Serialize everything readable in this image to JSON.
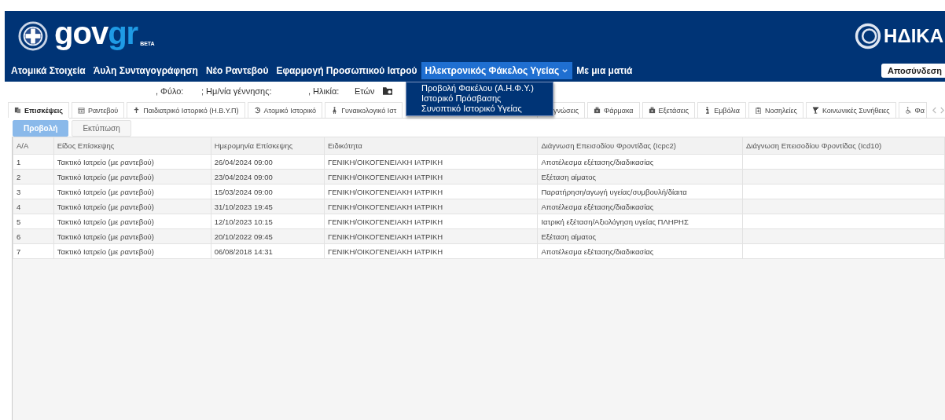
{
  "header": {
    "logo_text": "govgr",
    "badge": "BETA",
    "right_logo_text": "ΗΔΙΚΑ",
    "logout_button": "Αποσύνδεση"
  },
  "nav": [
    {
      "label": "Ατομικά Στοιχεία",
      "selected": false,
      "kind": "link"
    },
    {
      "label": "Άυλη Συνταγογράφηση",
      "selected": false,
      "kind": "link"
    },
    {
      "label": "Νέο Ραντεβού",
      "selected": false,
      "kind": "link"
    },
    {
      "label": "Εφαρμογή Προσωπικού Ιατρού",
      "selected": false,
      "kind": "link"
    },
    {
      "label": "Ηλεκτρονικός Φάκελος Υγείας",
      "selected": true,
      "kind": "menu"
    },
    {
      "label": "Με μια ματιά",
      "selected": false,
      "kind": "link"
    }
  ],
  "dropdown_menu": [
    "Προβολή Φακέλου (Α.Η.Φ.Υ.)",
    "Ιστορικό Πρόσβασης",
    "Συνοπτικό Ιστορικό Υγείας"
  ],
  "patient_info": [
    ", Φύλο:",
    "; Ημ/νία γέννησης:",
    ", Ηλικία:",
    "Ετών"
  ],
  "tabs": [
    {
      "label": "Επισκέψεις",
      "selected": true
    },
    {
      "label": "Ραντεβού",
      "selected": false
    },
    {
      "label": "Παιδιατρικό Ιστορικό (Η.Β.Υ.Π)",
      "selected": false
    },
    {
      "label": "Ατομικό Ιστορικό",
      "selected": false
    },
    {
      "label": "Γυναικολογικό Ιστ",
      "selected": false
    },
    {
      "label": "γνώσεις",
      "selected": false
    },
    {
      "label": "Φάρμακα",
      "selected": false
    },
    {
      "label": "Εξετάσεις",
      "selected": false
    },
    {
      "label": "Εμβόλια",
      "selected": false
    },
    {
      "label": "Νοσηλείες",
      "selected": false
    },
    {
      "label": "Κοινωνικές Συνήθειες",
      "selected": false
    },
    {
      "label": "Φα",
      "selected": false
    }
  ],
  "actions": [
    {
      "label": "Προβολή",
      "selected": true
    },
    {
      "label": "Εκτύπωση",
      "selected": false
    }
  ],
  "table": {
    "columns": [
      "Α/Α",
      "Είδος Επίσκεψης",
      "Ημερομηνία Επίσκεψης",
      "Ειδικότητα",
      "Διάγνωση Επεισοδίου Φροντίδας (Icpc2)",
      "Διάγνωση Επεισοδίου Φροντίδας (Icd10)"
    ],
    "rows": [
      [
        "1",
        "Τακτικό Ιατρείο (με ραντεβού)",
        "26/04/2024 09:00",
        "ΓΕΝΙΚΗ/ΟΙΚΟΓΕΝΕΙΑΚΗ ΙΑΤΡΙΚΗ",
        "Αποτέλεσμα εξέτασης/διαδικασίας"
      ],
      [
        "2",
        "Τακτικό Ιατρείο (με ραντεβού)",
        "23/04/2024 09:00",
        "ΓΕΝΙΚΗ/ΟΙΚΟΓΕΝΕΙΑΚΗ ΙΑΤΡΙΚΗ",
        "Εξέταση αίματος"
      ],
      [
        "3",
        "Τακτικό Ιατρείο (με ραντεβού)",
        "15/03/2024 09:00",
        "ΓΕΝΙΚΗ/ΟΙΚΟΓΕΝΕΙΑΚΗ ΙΑΤΡΙΚΗ",
        "Παρατήρηση/αγωγή υγείας/συμβουλή/δίαιτα"
      ],
      [
        "4",
        "Τακτικό Ιατρείο (με ραντεβού)",
        "31/10/2023 19:45",
        "ΓΕΝΙΚΗ/ΟΙΚΟΓΕΝΕΙΑΚΗ ΙΑΤΡΙΚΗ",
        "Αποτέλεσμα εξέτασης/διαδικασίας"
      ],
      [
        "5",
        "Τακτικό Ιατρείο (με ραντεβού)",
        "12/10/2023 10:15",
        "ΓΕΝΙΚΗ/ΟΙΚΟΓΕΝΕΙΑΚΗ ΙΑΤΡΙΚΗ",
        "Ιατρική εξέταση/Αξιολόγηση υγείας ΠΛΗΡΗΣ"
      ],
      [
        "6",
        "Τακτικό Ιατρείο (με ραντεβού)",
        "20/10/2022 09:45",
        "ΓΕΝΙΚΗ/ΟΙΚΟΓΕΝΕΙΑΚΗ ΙΑΤΡΙΚΗ",
        "Εξέταση αίματος"
      ],
      [
        "7",
        "Τακτικό Ιατρείο (με ραντεβού)",
        "06/08/2018 14:31",
        "ΓΕΝΙΚΗ/ΟΙΚΟΓΕΝΕΙΑΚΗ ΙΑΤΡΙΚΗ",
        "Αποτέλεσμα εξέτασης/διαδικασίας"
      ]
    ]
  }
}
